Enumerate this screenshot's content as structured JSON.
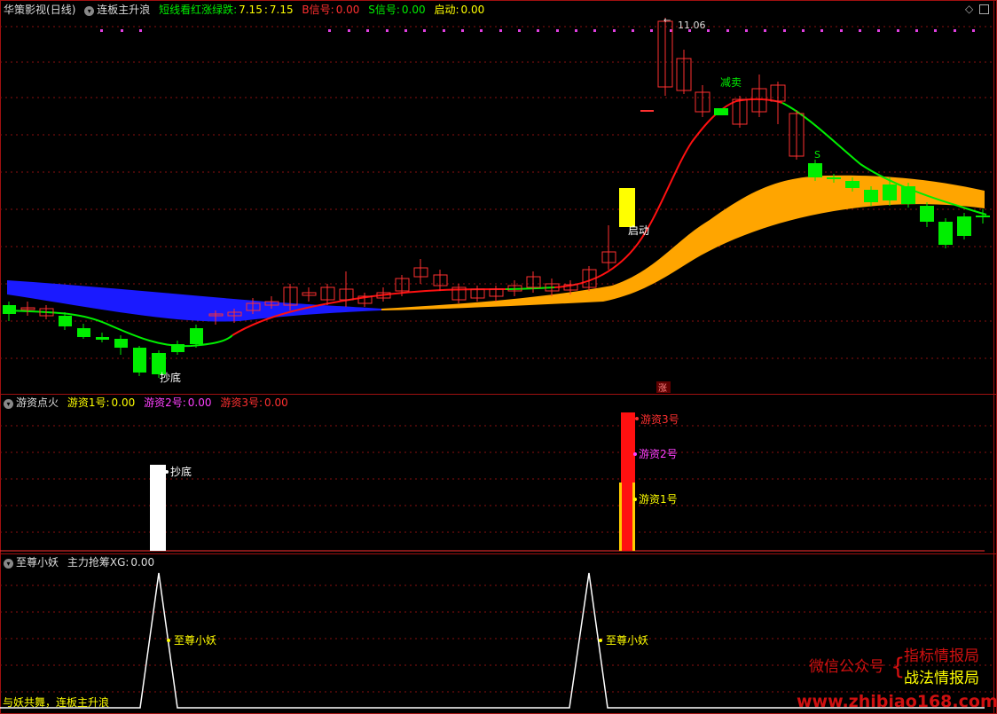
{
  "main_panel": {
    "stock_name": "华策影视",
    "period": "(日线)",
    "indicator_name": "连板主升浪",
    "short_line_label": "短线看红涨绿跌:",
    "short_line_value1": "7.15",
    "short_line_value2": "7.15",
    "b_signal_label": "B信号:",
    "b_signal_value": "0.00",
    "s_signal_label": "S信号:",
    "s_signal_value": "0.00",
    "start_label": "启动:",
    "start_value": "0.00",
    "peak_label": "11.06",
    "sell_label": "减卖",
    "start_annotation": "启动",
    "bottom_label": "抄底",
    "s_marker": "S",
    "zhang_label": "涨"
  },
  "panel2": {
    "indicator_name": "游资点火",
    "yz1_label": "游资1号:",
    "yz1_value": "0.00",
    "yz2_label": "游资2号:",
    "yz2_value": "0.00",
    "yz3_label": "游资3号:",
    "yz3_value": "0.00",
    "bar_bottom_label": "抄底",
    "bar_yz1": "游资1号",
    "bar_yz2": "游资2号",
    "bar_yz3": "游资3号"
  },
  "panel3": {
    "indicator_name": "至尊小妖",
    "xg_label": "主力抢筹XG:",
    "xg_value": "0.00",
    "peak1_label": "至尊小妖",
    "peak2_label": "至尊小妖",
    "footer": "与妖共舞，连板主升浪"
  },
  "watermark": {
    "wechat": "微信公众号",
    "line1": "指标情报局",
    "line2": "战法情报局",
    "url": "www.zhibiao168.com"
  },
  "colors": {
    "up": "#ff3030",
    "down": "#00ee00",
    "band_blue": "#1a1aff",
    "band_orange": "#ffa500",
    "start_yellow": "#ffff00"
  }
}
